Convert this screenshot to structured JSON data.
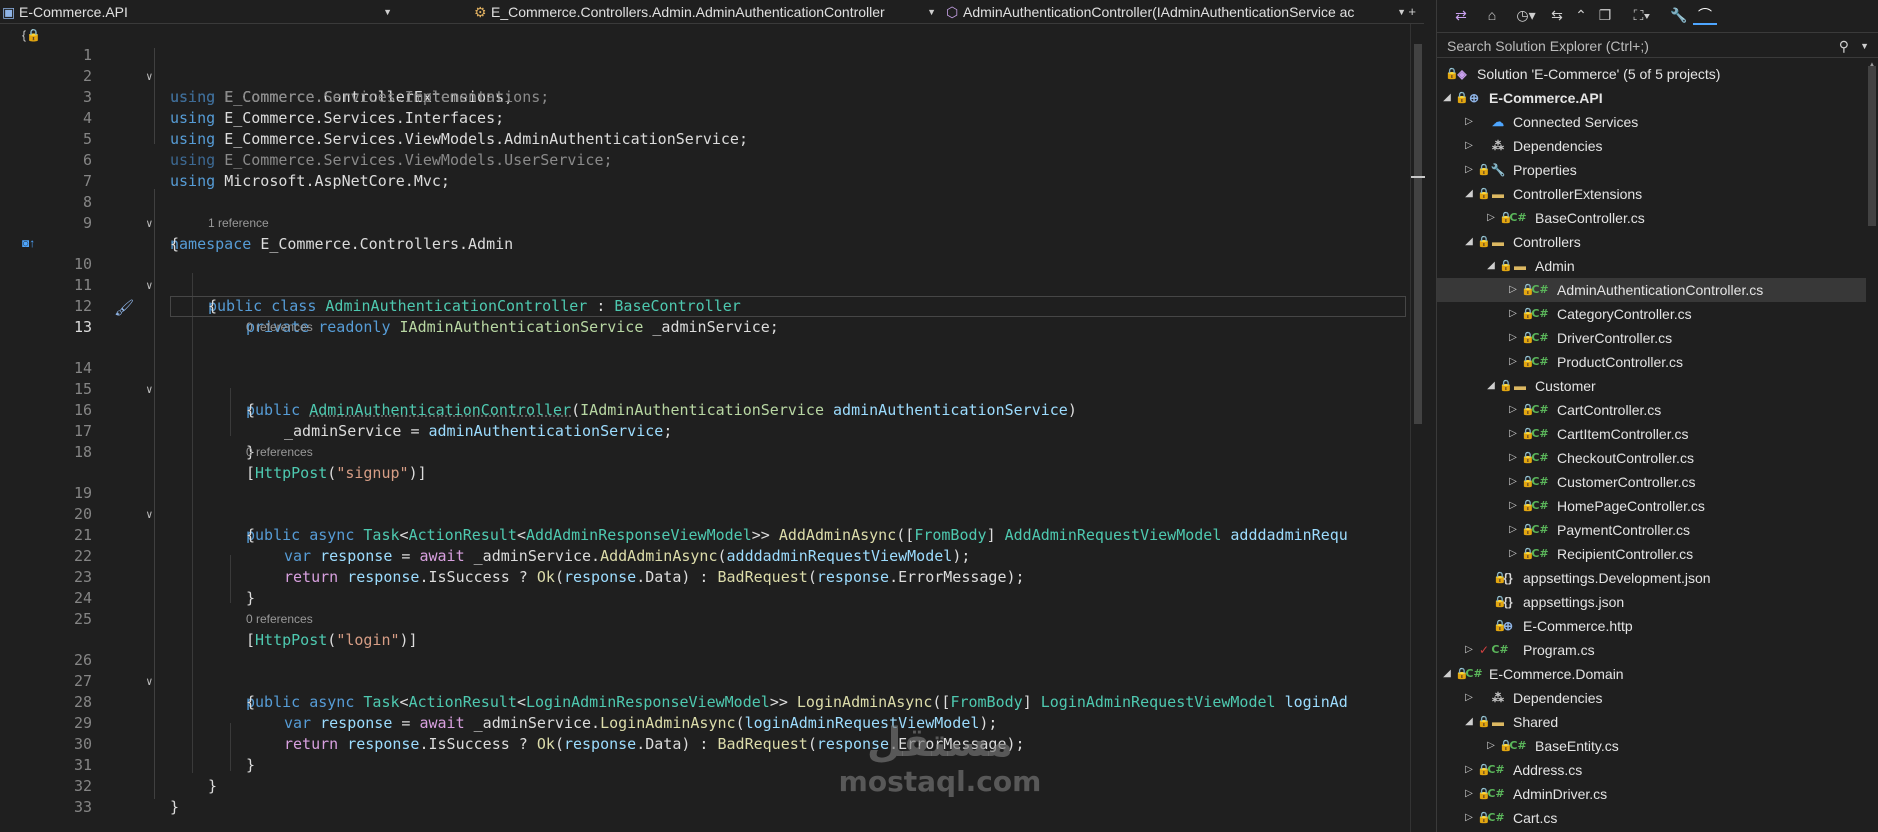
{
  "navbar": {
    "project": "E-Commerce.API",
    "class_path": "E_Commerce.Controllers.Admin.AdminAuthenticationController",
    "member": "AdminAuthenticationController(IAdminAuthenticationService ac"
  },
  "editor": {
    "line_numbers": [
      "1",
      "2",
      "3",
      "4",
      "5",
      "6",
      "7",
      "8",
      "9",
      "10",
      "11",
      "12",
      "13",
      "14",
      "15",
      "16",
      "17",
      "18",
      "19",
      "20",
      "21",
      "22",
      "23",
      "24",
      "25",
      "26",
      "27",
      "28",
      "29",
      "30",
      "31",
      "32",
      "33"
    ],
    "codelens": {
      "class_refs": "1 reference",
      "ctor_refs": "0 references",
      "signup_refs": "0 references",
      "login_refs": "0 references"
    },
    "lines": {
      "l1": [
        "using",
        "E_Commerce.ControllerExtensions;"
      ],
      "l2": [
        "using",
        "E_Commerce.Services.Implementations;"
      ],
      "l3": [
        "using",
        "E_Commerce.Services.Interfaces;"
      ],
      "l4": [
        "using",
        "E_Commerce.Services.ViewModels.AdminAuthenticationService;"
      ],
      "l5": [
        "using",
        "E_Commerce.Services.ViewModels.UserService;"
      ],
      "l6": [
        "using",
        "Microsoft.AspNetCore.Mvc;"
      ],
      "l8": [
        "namespace",
        "E_Commerce.Controllers.Admin"
      ],
      "l9": "{",
      "l10": [
        "public",
        "class",
        "AdminAuthenticationController",
        ":",
        "BaseController"
      ],
      "l11": "{",
      "l12": [
        "private",
        "readonly",
        "IAdminAuthenticationService",
        "_adminService;"
      ],
      "l14": [
        "public",
        "AdminAuthenticationController",
        "(",
        "IAdminAuthenticationService",
        "adminAuthenticationService",
        ")"
      ],
      "l15": "{",
      "l16": [
        "_adminService",
        "=",
        "adminAuthenticationService",
        ";"
      ],
      "l17": "}",
      "l18": [
        "[",
        "HttpPost",
        "(",
        "\"signup\"",
        ")]"
      ],
      "l19": [
        "public",
        "async",
        "Task",
        "<",
        "ActionResult",
        "<",
        "AddAdminResponseViewModel",
        ">>",
        "AddAdminAsync",
        "([",
        "FromBody",
        "]",
        "AddAdminRequestViewModel",
        "adddadminRequ"
      ],
      "l20": "{",
      "l21": [
        "var",
        "response",
        "=",
        "await",
        "_adminService.",
        "AddAdminAsync",
        "(",
        "adddadminRequestViewModel",
        ");"
      ],
      "l22": [
        "return",
        "response",
        ".IsSuccess ?",
        "Ok",
        "(",
        "response",
        ".Data) :",
        "BadRequest",
        "(",
        "response",
        ".ErrorMessage);"
      ],
      "l23": "}",
      "l25": [
        "[",
        "HttpPost",
        "(",
        "\"login\"",
        ")]"
      ],
      "l26": [
        "public",
        "async",
        "Task",
        "<",
        "ActionResult",
        "<",
        "LoginAdminResponseViewModel",
        ">>",
        "LoginAdminAsync",
        "([",
        "FromBody",
        "]",
        "LoginAdminRequestViewModel",
        "loginAd"
      ],
      "l27": "{",
      "l28": [
        "var",
        "response",
        "=",
        "await",
        "_adminService.",
        "LoginAdminAsync",
        "(",
        "loginAdminRequestViewModel",
        ");"
      ],
      "l29": [
        "return",
        "response",
        ".IsSuccess ?",
        "Ok",
        "(",
        "response",
        ".Data) :",
        "BadRequest",
        "(",
        "response",
        ".ErrorMessage);"
      ],
      "l30": "}",
      "l31": "}",
      "l32": "}"
    },
    "active_line": "13"
  },
  "watermark": {
    "arabic": "مستقل",
    "latin": "mostaql.com"
  },
  "solution_explorer": {
    "search_placeholder": "Search Solution Explorer (Ctrl+;)",
    "solution_label": "Solution 'E-Commerce' (5 of 5 projects)",
    "nodes": [
      {
        "label": "E-Commerce.API",
        "icon": "project-icon"
      },
      {
        "label": "Connected Services",
        "icon": "connected-services-icon"
      },
      {
        "label": "Dependencies",
        "icon": "dependencies-icon"
      },
      {
        "label": "Properties",
        "icon": "properties-icon"
      },
      {
        "label": "ControllerExtensions",
        "icon": "folder-icon"
      },
      {
        "label": "BaseController.cs",
        "icon": "csharp-file-icon"
      },
      {
        "label": "Controllers",
        "icon": "folder-icon"
      },
      {
        "label": "Admin",
        "icon": "folder-icon"
      },
      {
        "label": "AdminAuthenticationController.cs",
        "icon": "csharp-file-icon"
      },
      {
        "label": "CategoryController.cs",
        "icon": "csharp-file-icon"
      },
      {
        "label": "DriverController.cs",
        "icon": "csharp-file-icon"
      },
      {
        "label": "ProductController.cs",
        "icon": "csharp-file-icon"
      },
      {
        "label": "Customer",
        "icon": "folder-icon"
      },
      {
        "label": "CartController.cs",
        "icon": "csharp-file-icon"
      },
      {
        "label": "CartItemController.cs",
        "icon": "csharp-file-icon"
      },
      {
        "label": "CheckoutController.cs",
        "icon": "csharp-file-icon"
      },
      {
        "label": "CustomerController.cs",
        "icon": "csharp-file-icon"
      },
      {
        "label": "HomePageController.cs",
        "icon": "csharp-file-icon"
      },
      {
        "label": "PaymentController.cs",
        "icon": "csharp-file-icon"
      },
      {
        "label": "RecipientController.cs",
        "icon": "csharp-file-icon"
      },
      {
        "label": "appsettings.Development.json",
        "icon": "json-file-icon"
      },
      {
        "label": "appsettings.json",
        "icon": "json-file-icon"
      },
      {
        "label": "E-Commerce.http",
        "icon": "http-file-icon"
      },
      {
        "label": "Program.cs",
        "icon": "csharp-file-icon"
      },
      {
        "label": "E-Commerce.Domain",
        "icon": "project-icon"
      },
      {
        "label": "Dependencies",
        "icon": "dependencies-icon"
      },
      {
        "label": "Shared",
        "icon": "folder-icon"
      },
      {
        "label": "BaseEntity.cs",
        "icon": "csharp-file-icon"
      },
      {
        "label": "Address.cs",
        "icon": "csharp-file-icon"
      },
      {
        "label": "AdminDriver.cs",
        "icon": "csharp-file-icon"
      },
      {
        "label": "Cart.cs",
        "icon": "csharp-file-icon"
      }
    ]
  },
  "colors": {
    "background": "#1f1f1f",
    "keyword": "#569cd6",
    "type": "#4ec9b0",
    "method": "#dcdcaa",
    "string": "#d69d85",
    "parameter": "#9cdcfe",
    "selection": "#383838",
    "accent": "#4ea6ff"
  }
}
